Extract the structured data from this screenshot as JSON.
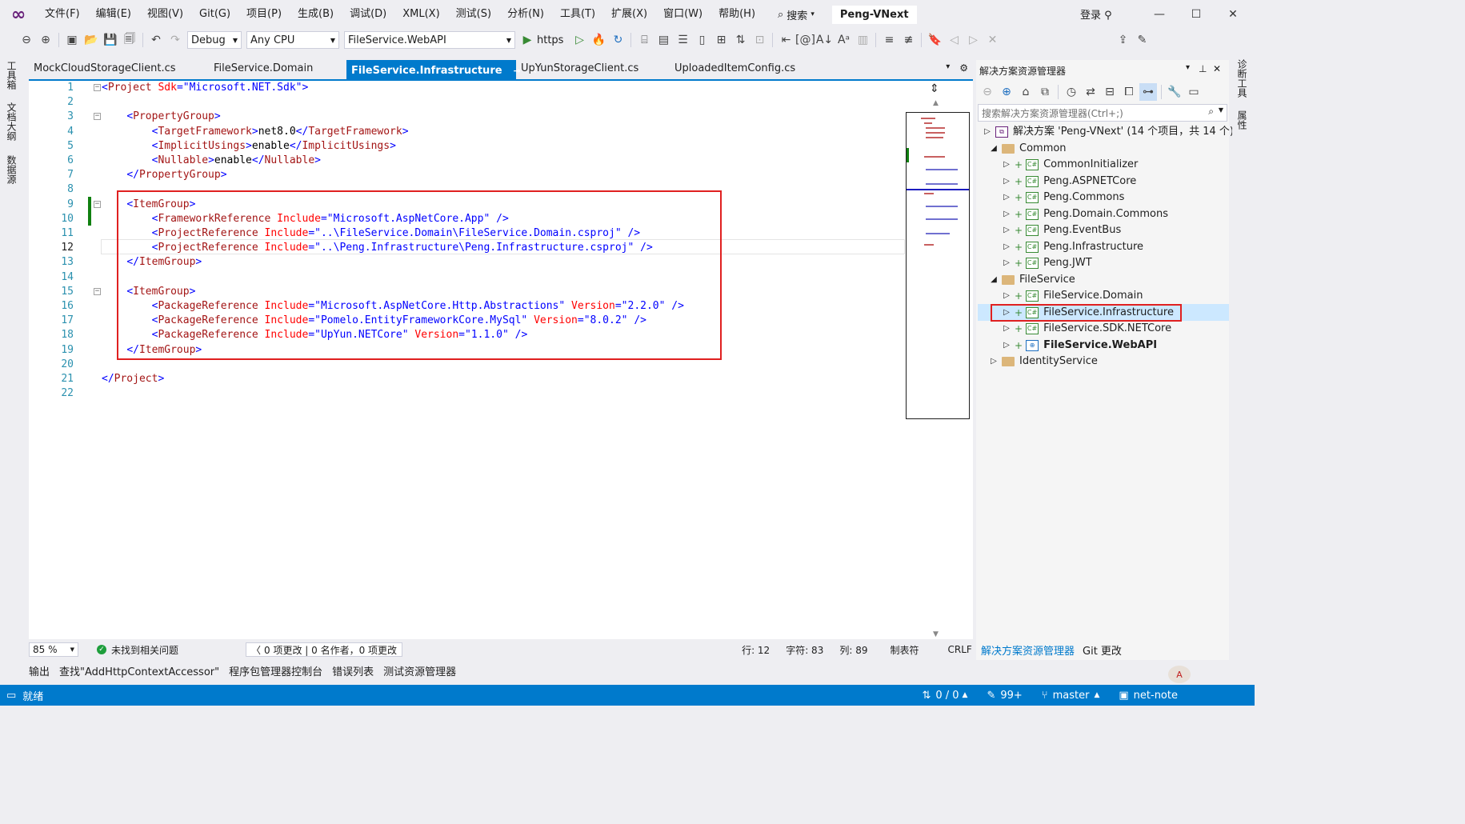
{
  "menubar": {
    "items": [
      "文件(F)",
      "编辑(E)",
      "视图(V)",
      "Git(G)",
      "项目(P)",
      "生成(B)",
      "调试(D)",
      "XML(X)",
      "测试(S)",
      "分析(N)",
      "工具(T)",
      "扩展(X)",
      "窗口(W)",
      "帮助(H)"
    ],
    "search_label": "搜索",
    "solution_name": "Peng-VNext",
    "login_label": "登录"
  },
  "toolbar": {
    "config": "Debug",
    "platform": "Any CPU",
    "startup_project": "FileService.WebAPI",
    "run_label": "https"
  },
  "left_strip": {
    "tabs": [
      "工具箱",
      "文档大纲",
      "数据源"
    ]
  },
  "right_strip": {
    "tabs": [
      "诊断工具",
      "属性"
    ]
  },
  "editor_tabs": [
    {
      "label": "MockCloudStorageClient.cs",
      "active": false
    },
    {
      "label": "FileService.Domain",
      "active": false
    },
    {
      "label": "FileService.Infrastructure",
      "active": true
    },
    {
      "label": "UpYunStorageClient.cs",
      "active": false
    },
    {
      "label": "UploadedItemConfig.cs",
      "active": false
    }
  ],
  "code": {
    "current_line": 12,
    "lines": [
      [
        [
          "br",
          "<"
        ],
        [
          "tag",
          "Project"
        ],
        [
          "txt",
          " "
        ],
        [
          "attr",
          "Sdk"
        ],
        [
          "br",
          "=\""
        ],
        [
          "val",
          "Microsoft.NET.Sdk"
        ],
        [
          "br",
          "\">"
        ]
      ],
      [],
      [
        [
          "txt",
          "    "
        ],
        [
          "br",
          "<"
        ],
        [
          "tag",
          "PropertyGroup"
        ],
        [
          "br",
          ">"
        ]
      ],
      [
        [
          "txt",
          "        "
        ],
        [
          "br",
          "<"
        ],
        [
          "tag",
          "TargetFramework"
        ],
        [
          "br",
          ">"
        ],
        [
          "txt",
          "net8.0"
        ],
        [
          "br",
          "</"
        ],
        [
          "tag",
          "TargetFramework"
        ],
        [
          "br",
          ">"
        ]
      ],
      [
        [
          "txt",
          "        "
        ],
        [
          "br",
          "<"
        ],
        [
          "tag",
          "ImplicitUsings"
        ],
        [
          "br",
          ">"
        ],
        [
          "txt",
          "enable"
        ],
        [
          "br",
          "</"
        ],
        [
          "tag",
          "ImplicitUsings"
        ],
        [
          "br",
          ">"
        ]
      ],
      [
        [
          "txt",
          "        "
        ],
        [
          "br",
          "<"
        ],
        [
          "tag",
          "Nullable"
        ],
        [
          "br",
          ">"
        ],
        [
          "txt",
          "enable"
        ],
        [
          "br",
          "</"
        ],
        [
          "tag",
          "Nullable"
        ],
        [
          "br",
          ">"
        ]
      ],
      [
        [
          "txt",
          "    "
        ],
        [
          "br",
          "</"
        ],
        [
          "tag",
          "PropertyGroup"
        ],
        [
          "br",
          ">"
        ]
      ],
      [],
      [
        [
          "txt",
          "    "
        ],
        [
          "br",
          "<"
        ],
        [
          "tag",
          "ItemGroup"
        ],
        [
          "br",
          ">"
        ]
      ],
      [
        [
          "txt",
          "        "
        ],
        [
          "br",
          "<"
        ],
        [
          "tag",
          "FrameworkReference"
        ],
        [
          "txt",
          " "
        ],
        [
          "attr",
          "Include"
        ],
        [
          "br",
          "=\""
        ],
        [
          "val",
          "Microsoft.AspNetCore.App"
        ],
        [
          "br",
          "\" />"
        ]
      ],
      [
        [
          "txt",
          "        "
        ],
        [
          "br",
          "<"
        ],
        [
          "tag",
          "ProjectReference"
        ],
        [
          "txt",
          " "
        ],
        [
          "attr",
          "Include"
        ],
        [
          "br",
          "=\""
        ],
        [
          "val",
          "..\\FileService.Domain\\FileService.Domain.csproj"
        ],
        [
          "br",
          "\" />"
        ]
      ],
      [
        [
          "txt",
          "        "
        ],
        [
          "br",
          "<"
        ],
        [
          "tag",
          "ProjectReference"
        ],
        [
          "txt",
          " "
        ],
        [
          "attr",
          "Include"
        ],
        [
          "br",
          "=\""
        ],
        [
          "val",
          "..\\Peng.Infrastructure\\Peng.Infrastructure.csproj"
        ],
        [
          "br",
          "\" />"
        ]
      ],
      [
        [
          "txt",
          "    "
        ],
        [
          "br",
          "</"
        ],
        [
          "tag",
          "ItemGroup"
        ],
        [
          "br",
          ">"
        ]
      ],
      [],
      [
        [
          "txt",
          "    "
        ],
        [
          "br",
          "<"
        ],
        [
          "tag",
          "ItemGroup"
        ],
        [
          "br",
          ">"
        ]
      ],
      [
        [
          "txt",
          "        "
        ],
        [
          "br",
          "<"
        ],
        [
          "tag",
          "PackageReference"
        ],
        [
          "txt",
          " "
        ],
        [
          "attr",
          "Include"
        ],
        [
          "br",
          "=\""
        ],
        [
          "val",
          "Microsoft.AspNetCore.Http.Abstractions"
        ],
        [
          "br",
          "\" "
        ],
        [
          "attr",
          "Version"
        ],
        [
          "br",
          "=\""
        ],
        [
          "val",
          "2.2.0"
        ],
        [
          "br",
          "\" />"
        ]
      ],
      [
        [
          "txt",
          "        "
        ],
        [
          "br",
          "<"
        ],
        [
          "tag",
          "PackageReference"
        ],
        [
          "txt",
          " "
        ],
        [
          "attr",
          "Include"
        ],
        [
          "br",
          "=\""
        ],
        [
          "val",
          "Pomelo.EntityFrameworkCore.MySql"
        ],
        [
          "br",
          "\" "
        ],
        [
          "attr",
          "Version"
        ],
        [
          "br",
          "=\""
        ],
        [
          "val",
          "8.0.2"
        ],
        [
          "br",
          "\" />"
        ]
      ],
      [
        [
          "txt",
          "        "
        ],
        [
          "br",
          "<"
        ],
        [
          "tag",
          "PackageReference"
        ],
        [
          "txt",
          " "
        ],
        [
          "attr",
          "Include"
        ],
        [
          "br",
          "=\""
        ],
        [
          "val",
          "UpYun.NETCore"
        ],
        [
          "br",
          "\" "
        ],
        [
          "attr",
          "Version"
        ],
        [
          "br",
          "=\""
        ],
        [
          "val",
          "1.1.0"
        ],
        [
          "br",
          "\" />"
        ]
      ],
      [
        [
          "txt",
          "    "
        ],
        [
          "br",
          "</"
        ],
        [
          "tag",
          "ItemGroup"
        ],
        [
          "br",
          ">"
        ]
      ],
      [],
      [
        [
          "br",
          "</"
        ],
        [
          "tag",
          "Project"
        ],
        [
          "br",
          ">"
        ]
      ],
      []
    ]
  },
  "editor_status": {
    "zoom": "85 %",
    "issues": "未找到相关问题",
    "changes": "0 项更改 | 0 名作者，0 项更改",
    "line": "行: 12",
    "char": "字符: 83",
    "col": "列: 89",
    "tabs": "制表符",
    "eol": "CRLF"
  },
  "solution_explorer": {
    "title": "解决方案资源管理器",
    "search_placeholder": "搜索解决方案资源管理器(Ctrl+;)",
    "solution_label": "解决方案 'Peng-VNext' (14 个项目，共 14 个)",
    "folders": [
      {
        "name": "Common",
        "expanded": true,
        "projects": [
          "CommonInitializer",
          "Peng.ASPNETCore",
          "Peng.Commons",
          "Peng.Domain.Commons",
          "Peng.EventBus",
          "Peng.Infrastructure",
          "Peng.JWT"
        ]
      },
      {
        "name": "FileService",
        "expanded": true,
        "projects": [
          "FileService.Domain",
          "FileService.Infrastructure",
          "FileService.SDK.NETCore",
          "FileService.WebAPI"
        ]
      },
      {
        "name": "IdentityService",
        "expanded": false,
        "projects": []
      }
    ],
    "selected_project": "FileService.Infrastructure",
    "bold_project": "FileService.WebAPI",
    "bottom_tabs": [
      "解决方案资源管理器",
      "Git 更改"
    ]
  },
  "output_tabs": [
    "输出",
    "查找\"AddHttpContextAccessor\"",
    "程序包管理器控制台",
    "错误列表",
    "测试资源管理器"
  ],
  "statusbar": {
    "ready": "就绪",
    "sync": "0 / 0",
    "edits": "99+",
    "branch": "master",
    "repo": "net-note"
  },
  "colors": {
    "accent": "#007acc",
    "highlight_box": "#e02020"
  }
}
